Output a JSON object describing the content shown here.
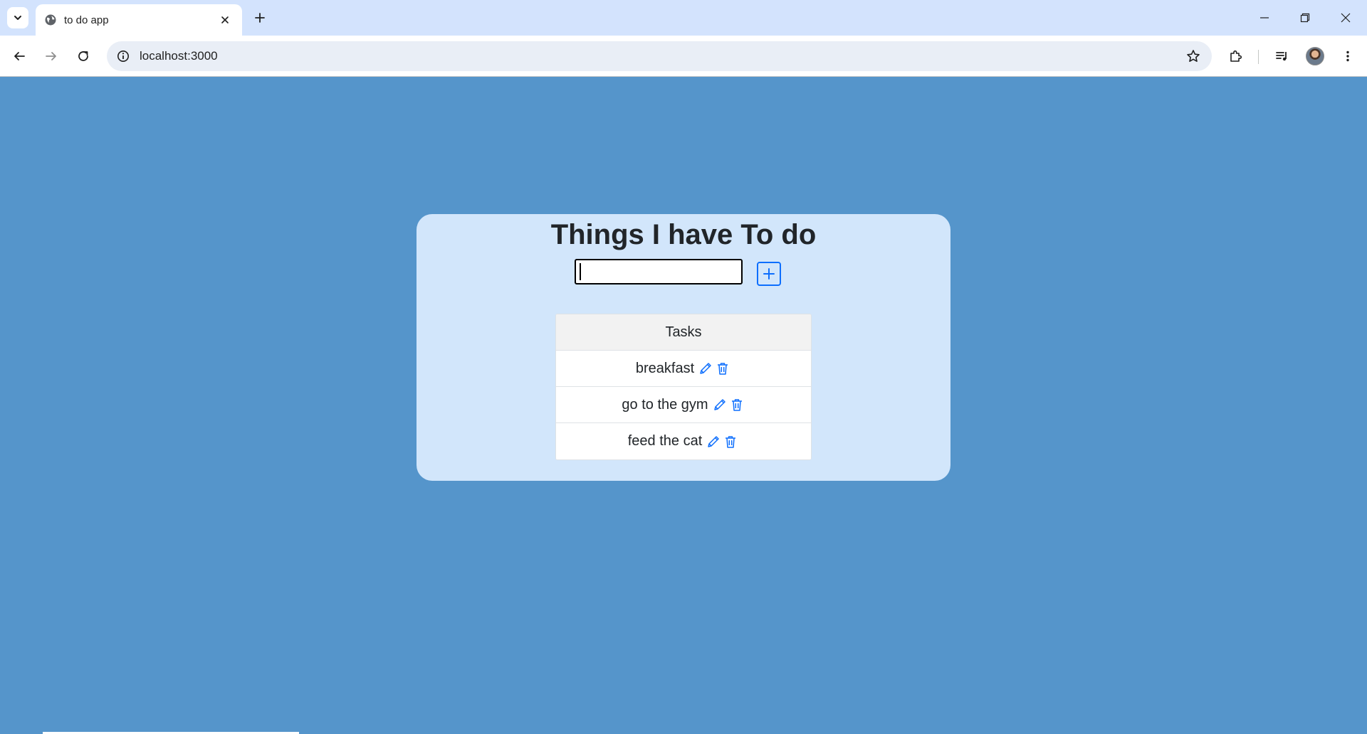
{
  "browser": {
    "tab_title": "to do app",
    "url": "localhost:3000"
  },
  "app": {
    "title": "Things I have To do",
    "input_value": "",
    "tasks_header": "Tasks",
    "tasks": [
      {
        "label": "breakfast"
      },
      {
        "label": "go to the gym"
      },
      {
        "label": "feed the cat"
      }
    ]
  },
  "colors": {
    "page_background": "#5595cb",
    "card_background": "#d2e6fb",
    "accent": "#0d6efd",
    "tabstrip": "#d3e3fd"
  },
  "icons": {
    "tab_favicon": "globe-icon",
    "add": "plus-square-icon",
    "edit": "pencil-icon",
    "delete": "trash-icon"
  }
}
